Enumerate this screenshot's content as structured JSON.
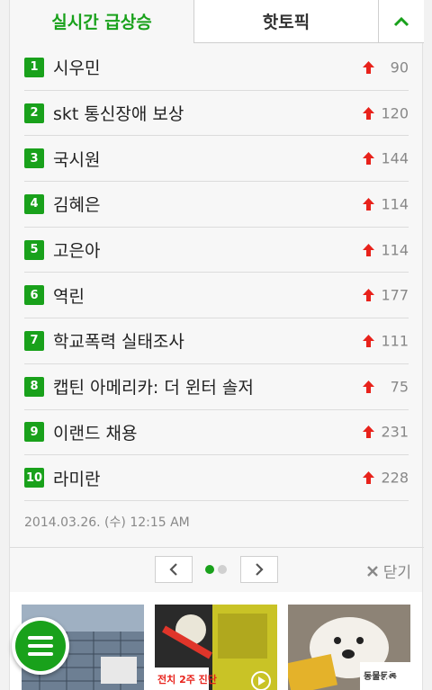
{
  "tabs": {
    "active_label": "실시간 급상승",
    "inactive_label": "핫토픽",
    "toggle_icon": "chevron-up-icon"
  },
  "colors": {
    "accent": "#19a11b",
    "rise": "#e8221b"
  },
  "ranking": [
    {
      "rank": "1",
      "term": "시우민",
      "score": "90"
    },
    {
      "rank": "2",
      "term": "skt 통신장애 보상",
      "score": "120"
    },
    {
      "rank": "3",
      "term": "국시원",
      "score": "144"
    },
    {
      "rank": "4",
      "term": "김혜은",
      "score": "114"
    },
    {
      "rank": "5",
      "term": "고은아",
      "score": "114"
    },
    {
      "rank": "6",
      "term": "역린",
      "score": "177"
    },
    {
      "rank": "7",
      "term": "학교폭력 실태조사",
      "score": "111"
    },
    {
      "rank": "8",
      "term": "캡틴 아메리카: 더 윈터 솔저",
      "score": "75"
    },
    {
      "rank": "9",
      "term": "이랜드 채용",
      "score": "231"
    },
    {
      "rank": "10",
      "term": "라미란",
      "score": "228"
    }
  ],
  "timestamp": "2014.03.26. (수) 12:15 AM",
  "pager": {
    "prev_icon": "chevron-left-icon",
    "next_icon": "chevron-right-icon",
    "pages": 2,
    "current": 1
  },
  "close": {
    "label": "닫기",
    "icon": "close-x-icon"
  },
  "thumbnails": [
    {
      "icon": "thumbnail-image"
    },
    {
      "icon": "thumbnail-image",
      "caption": "전치 2주 진단",
      "play_icon": "play-icon"
    },
    {
      "icon": "thumbnail-image",
      "caption": "동물등록",
      "play_icon": "play-icon"
    }
  ],
  "fab": {
    "icon": "menu-icon"
  }
}
